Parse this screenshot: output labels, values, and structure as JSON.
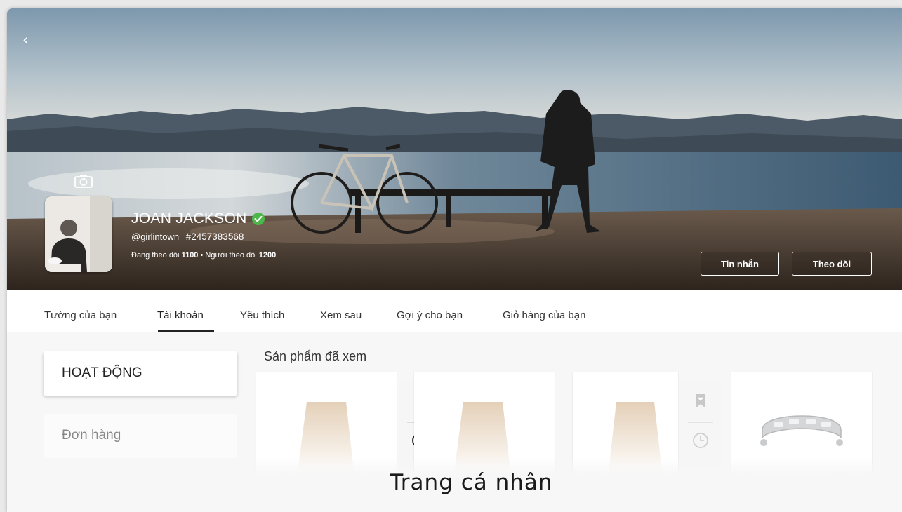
{
  "header": {
    "back_icon": "chevron-left-icon",
    "camera_icon": "camera-icon",
    "name": "JOAN JACKSON",
    "verified_icon": "verified-check-icon",
    "verified_color": "#4cb84a",
    "handle": "@girlintown",
    "user_id": "#2457383568",
    "following_label": "Đang theo dõi",
    "following_count": "1100",
    "separator": "•",
    "followers_label": "Người theo dõi",
    "followers_count": "1200",
    "message_button": "Tin nhắn",
    "follow_button": "Theo dõi"
  },
  "tabs": [
    {
      "label": "Tường của bạn",
      "active": false
    },
    {
      "label": "Tài khoản",
      "active": true
    },
    {
      "label": "Yêu thích",
      "active": false
    },
    {
      "label": "Xem sau",
      "active": false
    },
    {
      "label": "Gợi ý cho bạn",
      "active": false
    },
    {
      "label": "Giỏ hàng của bạn",
      "active": false
    }
  ],
  "sidebar": {
    "active_section": "HOẠT ĐỘNG",
    "items": [
      {
        "label": "Đơn hàng"
      }
    ]
  },
  "main": {
    "section_title": "Sản phẩm đã xem",
    "products": [
      {
        "kind": "skirt",
        "bookmark_icon": "bookmark-heart-icon",
        "history_icon": "clock-icon",
        "actions_active": true
      },
      {
        "kind": "skirt"
      },
      {
        "kind": "skirt",
        "bookmark_icon": "bookmark-heart-icon",
        "history_icon": "clock-icon",
        "actions_active": false
      },
      {
        "kind": "bracelet"
      }
    ]
  },
  "caption": "Trang cá nhân",
  "colors": {
    "accent_dark": "#222222",
    "muted_text": "#888888",
    "skirt_tone": "#ead8c2"
  }
}
